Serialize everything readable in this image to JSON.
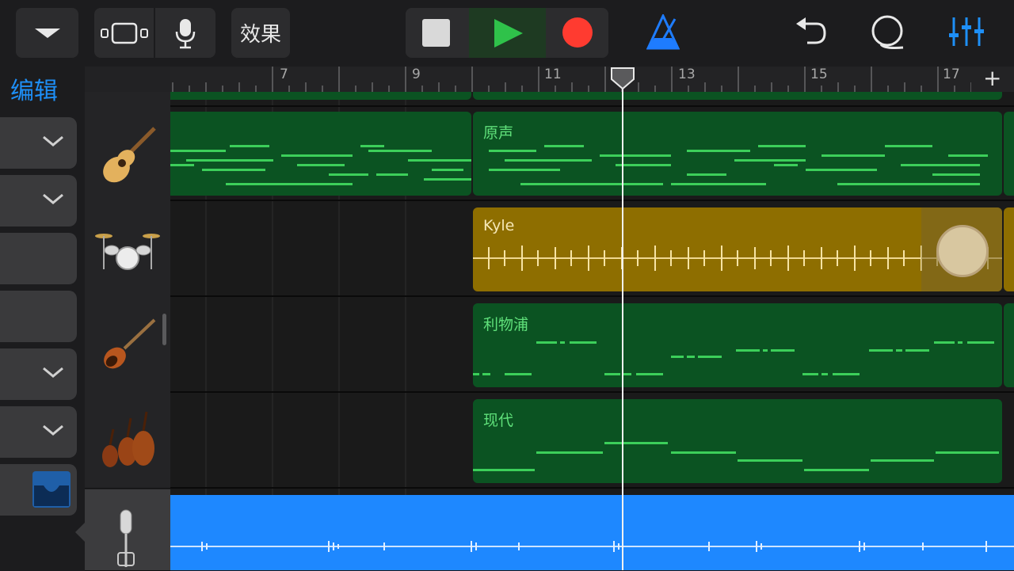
{
  "toolbar": {
    "fx_label": "效果",
    "icons": [
      "chevron-down-icon",
      "track-view-icon",
      "microphone-icon",
      "stop-icon",
      "play-icon",
      "record-icon",
      "metronome-icon",
      "undo-icon",
      "loop-icon",
      "mixer-icon"
    ],
    "colors": {
      "play": "#2fc24a",
      "record": "#ff3b30",
      "metronome": "#1e7cff",
      "mixer": "#1e8ff7"
    }
  },
  "left_panel": {
    "edit_label": "编辑"
  },
  "ruler": {
    "bars": [
      "7",
      "9",
      "11",
      "13",
      "15",
      "17"
    ],
    "add_label": "+"
  },
  "tracks": [
    {
      "instrument": "acoustic-guitar-icon",
      "region_name": "原声",
      "color": "#0b5322"
    },
    {
      "instrument": "drum-kit-icon",
      "region_name": "Kyle",
      "color": "#8e6e00"
    },
    {
      "instrument": "bass-guitar-icon",
      "region_name": "利物浦",
      "color": "#0b5322"
    },
    {
      "instrument": "strings-icon",
      "region_name": "现代",
      "color": "#0b5322"
    },
    {
      "instrument": "microphone-icon",
      "region_name": "",
      "color": "#1e88ff"
    }
  ]
}
